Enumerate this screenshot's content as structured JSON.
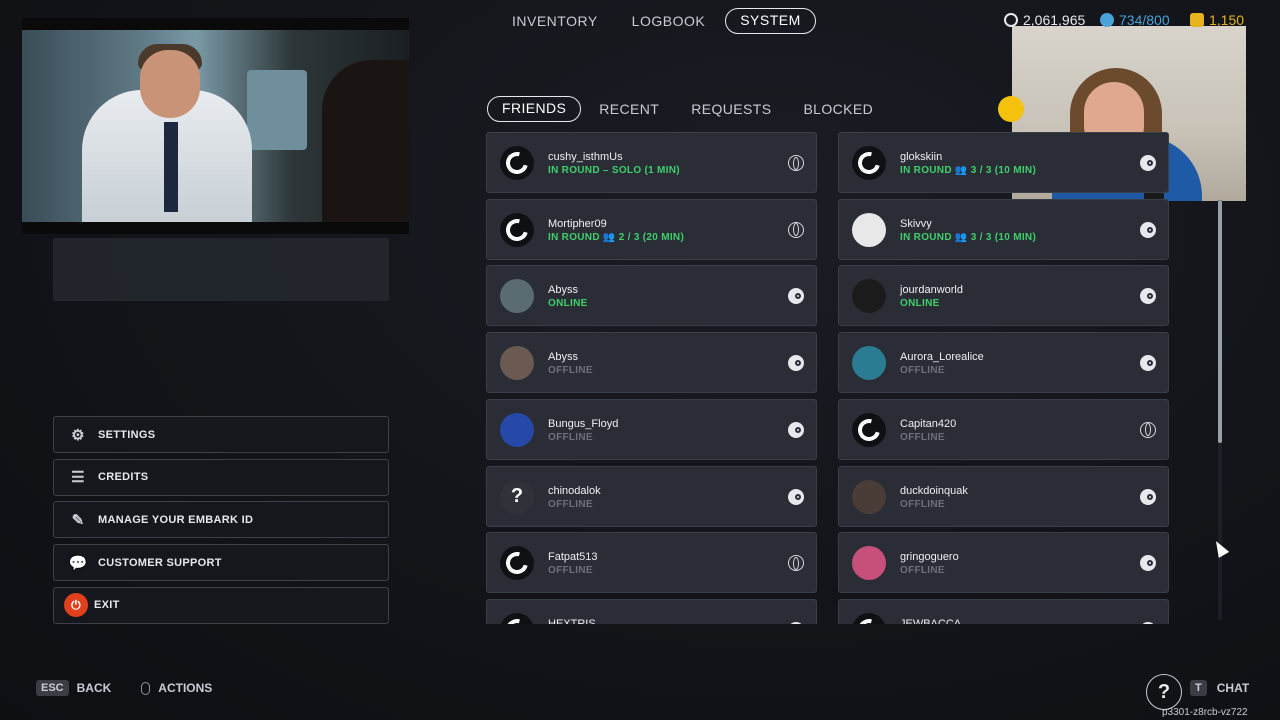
{
  "topnav": {
    "tabs": [
      {
        "label": "INVENTORY",
        "active": false
      },
      {
        "label": "LOGBOOK",
        "active": false
      },
      {
        "label": "SYSTEM",
        "active": true
      }
    ]
  },
  "currencies": {
    "multibucks": "2,061,965",
    "tokens": "734/800",
    "kudos": "1,150"
  },
  "left_menu": {
    "settings": "SETTINGS",
    "credits": "CREDITS",
    "manage_id": "MANAGE YOUR EMBARK ID",
    "support": "CUSTOMER SUPPORT",
    "exit": "EXIT"
  },
  "friend_tabs": [
    {
      "label": "FRIENDS",
      "active": true
    },
    {
      "label": "RECENT",
      "active": false
    },
    {
      "label": "REQUESTS",
      "active": false
    },
    {
      "label": "BLOCKED",
      "active": false
    }
  ],
  "friends": [
    {
      "name": "cushy_isthmUs",
      "status": "IN ROUND – SOLO (1 MIN)",
      "online": true,
      "platform": "globe",
      "avatar": "embark-logo"
    },
    {
      "name": "glokskiin",
      "status": "IN ROUND 👥 3 / 3 (10 MIN)",
      "online": true,
      "platform": "steam",
      "avatar": "embark-logo"
    },
    {
      "name": "Mortipher09",
      "status": "IN ROUND 👥 2 / 3 (20 MIN)",
      "online": true,
      "platform": "globe",
      "avatar": "embark-logo"
    },
    {
      "name": "Skivvy",
      "status": "IN ROUND 👥 3 / 3 (10 MIN)",
      "online": true,
      "platform": "steam",
      "avatar": "poker-chip"
    },
    {
      "name": "Abyss",
      "status": "ONLINE",
      "online": true,
      "platform": "steam",
      "avatar": "character"
    },
    {
      "name": "jourdanworld",
      "status": "ONLINE",
      "online": true,
      "platform": "steam",
      "avatar": "sunglasses"
    },
    {
      "name": "Abyss",
      "status": "OFFLINE",
      "online": false,
      "platform": "steam",
      "avatar": "character-2"
    },
    {
      "name": "Aurora_Lorealice",
      "status": "OFFLINE",
      "online": false,
      "platform": "steam",
      "avatar": "cube"
    },
    {
      "name": "Bungus_Floyd",
      "status": "OFFLINE",
      "online": false,
      "platform": "steam",
      "avatar": "sonic"
    },
    {
      "name": "Capitan420",
      "status": "OFFLINE",
      "online": false,
      "platform": "globe",
      "avatar": "embark-logo"
    },
    {
      "name": "chinodalok",
      "status": "OFFLINE",
      "online": false,
      "platform": "steam",
      "avatar": "question"
    },
    {
      "name": "duckdoinquak",
      "status": "OFFLINE",
      "online": false,
      "platform": "steam",
      "avatar": "monster"
    },
    {
      "name": "Fatpat513",
      "status": "OFFLINE",
      "online": false,
      "platform": "globe",
      "avatar": "embark-logo"
    },
    {
      "name": "gringoguero",
      "status": "OFFLINE",
      "online": false,
      "platform": "steam",
      "avatar": "bear"
    },
    {
      "name": "HEXTRIS",
      "status": "",
      "online": false,
      "platform": "steam",
      "avatar": "embark-logo"
    },
    {
      "name": "JEWBACCA",
      "status": "",
      "online": false,
      "platform": "steam",
      "avatar": "embark-logo"
    }
  ],
  "bottom": {
    "esc_key": "ESC",
    "back": "BACK",
    "actions": "ACTIONS",
    "chat_key": "T",
    "chat": "CHAT",
    "help": "?",
    "session_id": "p3301-z8rcb-vz722"
  },
  "colors": {
    "online": "#3ecf6c",
    "offline": "#6c7079",
    "exit": "#e0401c",
    "accent_yellow": "#f4c20d"
  }
}
